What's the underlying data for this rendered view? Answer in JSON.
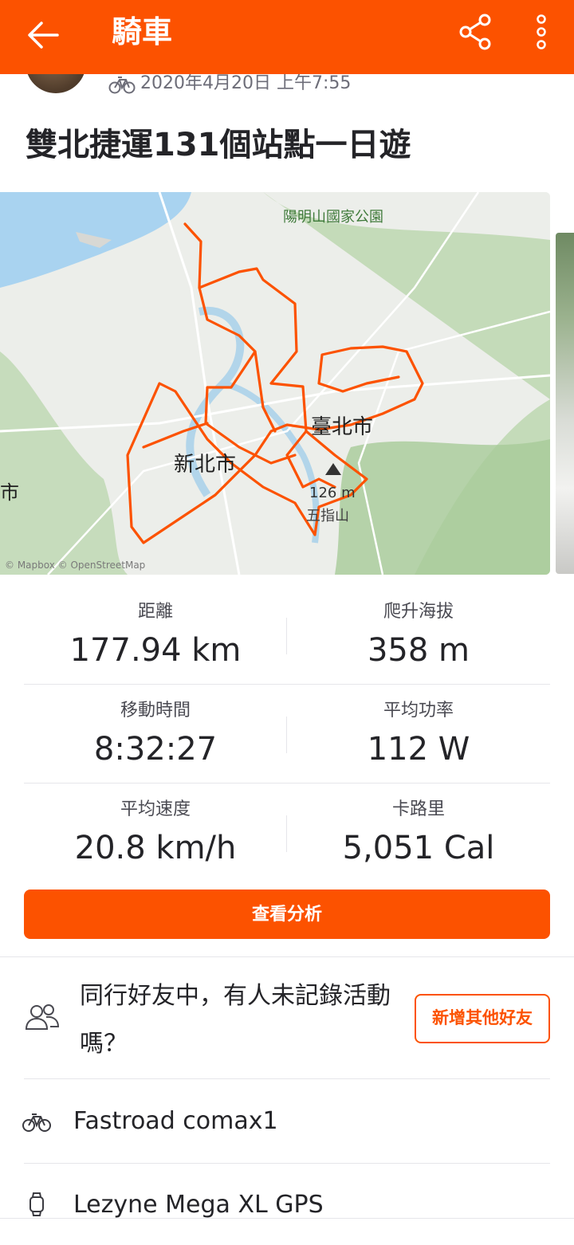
{
  "appbar": {
    "title": "騎車",
    "back_icon": "arrow-left-icon",
    "share_icon": "share-icon",
    "more_icon": "more-vertical-icon",
    "color": "#fc5200"
  },
  "activity": {
    "date": "2020年4月20日 上午7:55",
    "title": "雙北捷運131個站點一日遊"
  },
  "map": {
    "labels": {
      "park": "陽明山國家公園",
      "taipei": "臺北市",
      "new_taipei": "新北市",
      "edge_city": "市",
      "elevation": "126 m",
      "mountain": "五指山",
      "attribution": "© Mapbox © OpenStreetMap"
    },
    "route_color": "#fc5200"
  },
  "stats": {
    "distance": {
      "label": "距離",
      "value": "177.94 km"
    },
    "elevation_gain": {
      "label": "爬升海拔",
      "value": "358 m"
    },
    "moving_time": {
      "label": "移動時間",
      "value": "8:32:27"
    },
    "avg_power": {
      "label": "平均功率",
      "value": "112 W"
    },
    "avg_speed": {
      "label": "平均速度",
      "value": "20.8 km/h"
    },
    "calories": {
      "label": "卡路里",
      "value": "5,051 Cal"
    }
  },
  "analyze_button": "查看分析",
  "group": {
    "prompt": "同行好友中，有人未記錄活動嗎？",
    "add_button": "新增其他好友"
  },
  "gear": [
    {
      "icon": "bike-icon",
      "name": "Fastroad comax1"
    },
    {
      "icon": "watch-icon",
      "name": "Lezyne Mega XL GPS"
    }
  ]
}
